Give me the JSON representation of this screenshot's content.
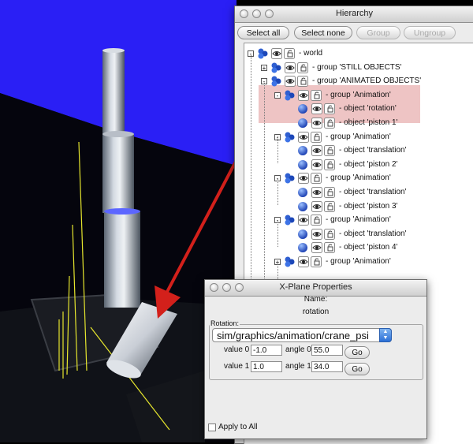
{
  "hierarchy": {
    "title": "Hierarchy",
    "buttons": {
      "select_all": "Select all",
      "select_none": "Select none",
      "group": "Group",
      "ungroup": "Ungroup"
    },
    "rows": [
      {
        "label": "- world",
        "icon": "group-icon"
      },
      {
        "label": "- group  'STILL OBJECTS'",
        "icon": "group-icon"
      },
      {
        "label": "- group  'ANIMATED OBJECTS'",
        "icon": "group-icon"
      },
      {
        "label": "- group  'Animation'",
        "icon": "group-icon"
      },
      {
        "label": "- object  'rotation'",
        "icon": "object-icon"
      },
      {
        "label": "- object  'piston 1'",
        "icon": "object-icon"
      },
      {
        "label": "- group  'Animation'",
        "icon": "group-icon"
      },
      {
        "label": "- object  'translation'",
        "icon": "object-icon"
      },
      {
        "label": "- object  'piston 2'",
        "icon": "object-icon"
      },
      {
        "label": "- group  'Animation'",
        "icon": "group-icon"
      },
      {
        "label": "- object  'translation'",
        "icon": "object-icon"
      },
      {
        "label": "- object  'piston 3'",
        "icon": "object-icon"
      },
      {
        "label": "- group  'Animation'",
        "icon": "group-icon"
      },
      {
        "label": "- object  'translation'",
        "icon": "object-icon"
      },
      {
        "label": "- object  'piston 4'",
        "icon": "object-icon"
      },
      {
        "label": "- group  'Animation'",
        "icon": "group-icon"
      }
    ]
  },
  "properties": {
    "title": "X-Plane Properties",
    "name_label": "Name:",
    "name_value": "rotation",
    "rotation_label": "Rotation:",
    "dataref": "sim/graphics/animation/crane_psi",
    "value0_label": "value 0",
    "value0": "-1.0",
    "angle0_label": "angle 0",
    "angle0": "55.0",
    "value1_label": "value 1",
    "value1": "1.0",
    "angle1_label": "angle 1",
    "angle1": "34.0",
    "go_label": "Go",
    "apply_all_label": "Apply to All"
  },
  "colors": {
    "viewport_blue": "#2a1ff5",
    "highlight": "#eec4c4",
    "arrow": "#d3201b",
    "accent": "#2a6fd6"
  }
}
